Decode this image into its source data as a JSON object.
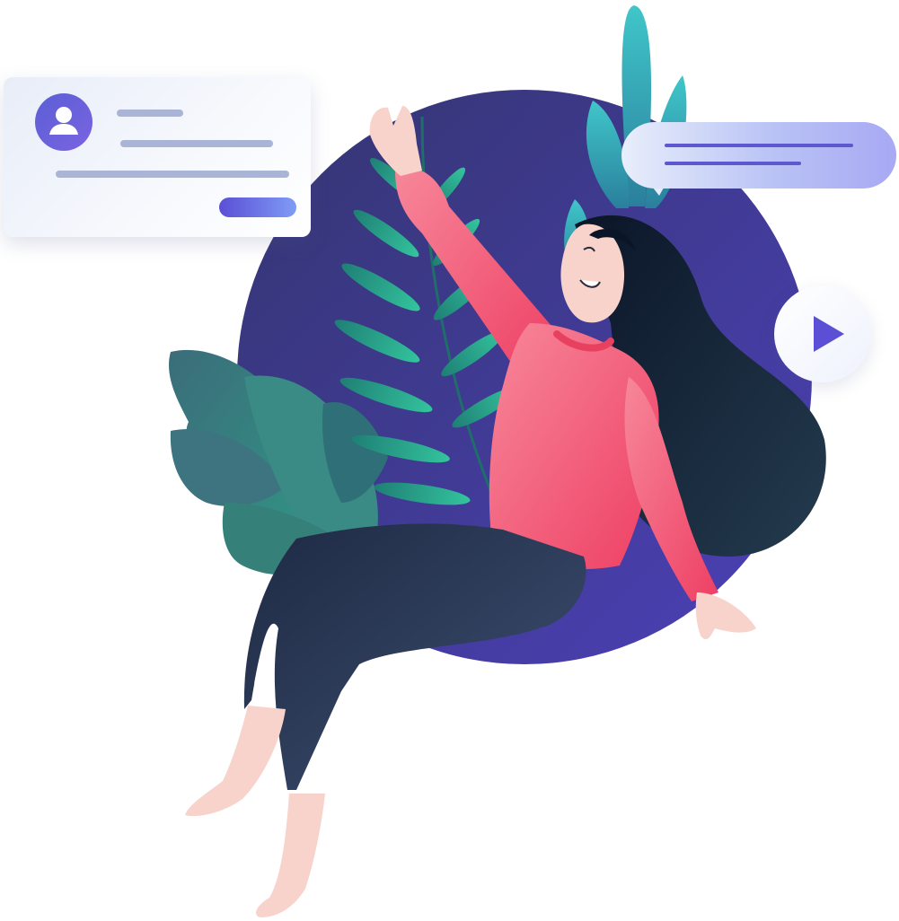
{
  "profile_card": {
    "avatar_icon": "user-icon",
    "button_label": ""
  },
  "chat_bubble": {
    "lines": 2
  },
  "play_button": {
    "icon": "play-icon"
  },
  "colors": {
    "circle": "#3f3a86",
    "accent_purple": "#5b4fd6",
    "sweater": "#f0607c",
    "hair": "#0f1f33",
    "pants": "#2f3d5c",
    "skin": "#f7d3cc",
    "leaf_dark": "#3f7c7c",
    "leaf_teal": "#2fbfa0"
  }
}
